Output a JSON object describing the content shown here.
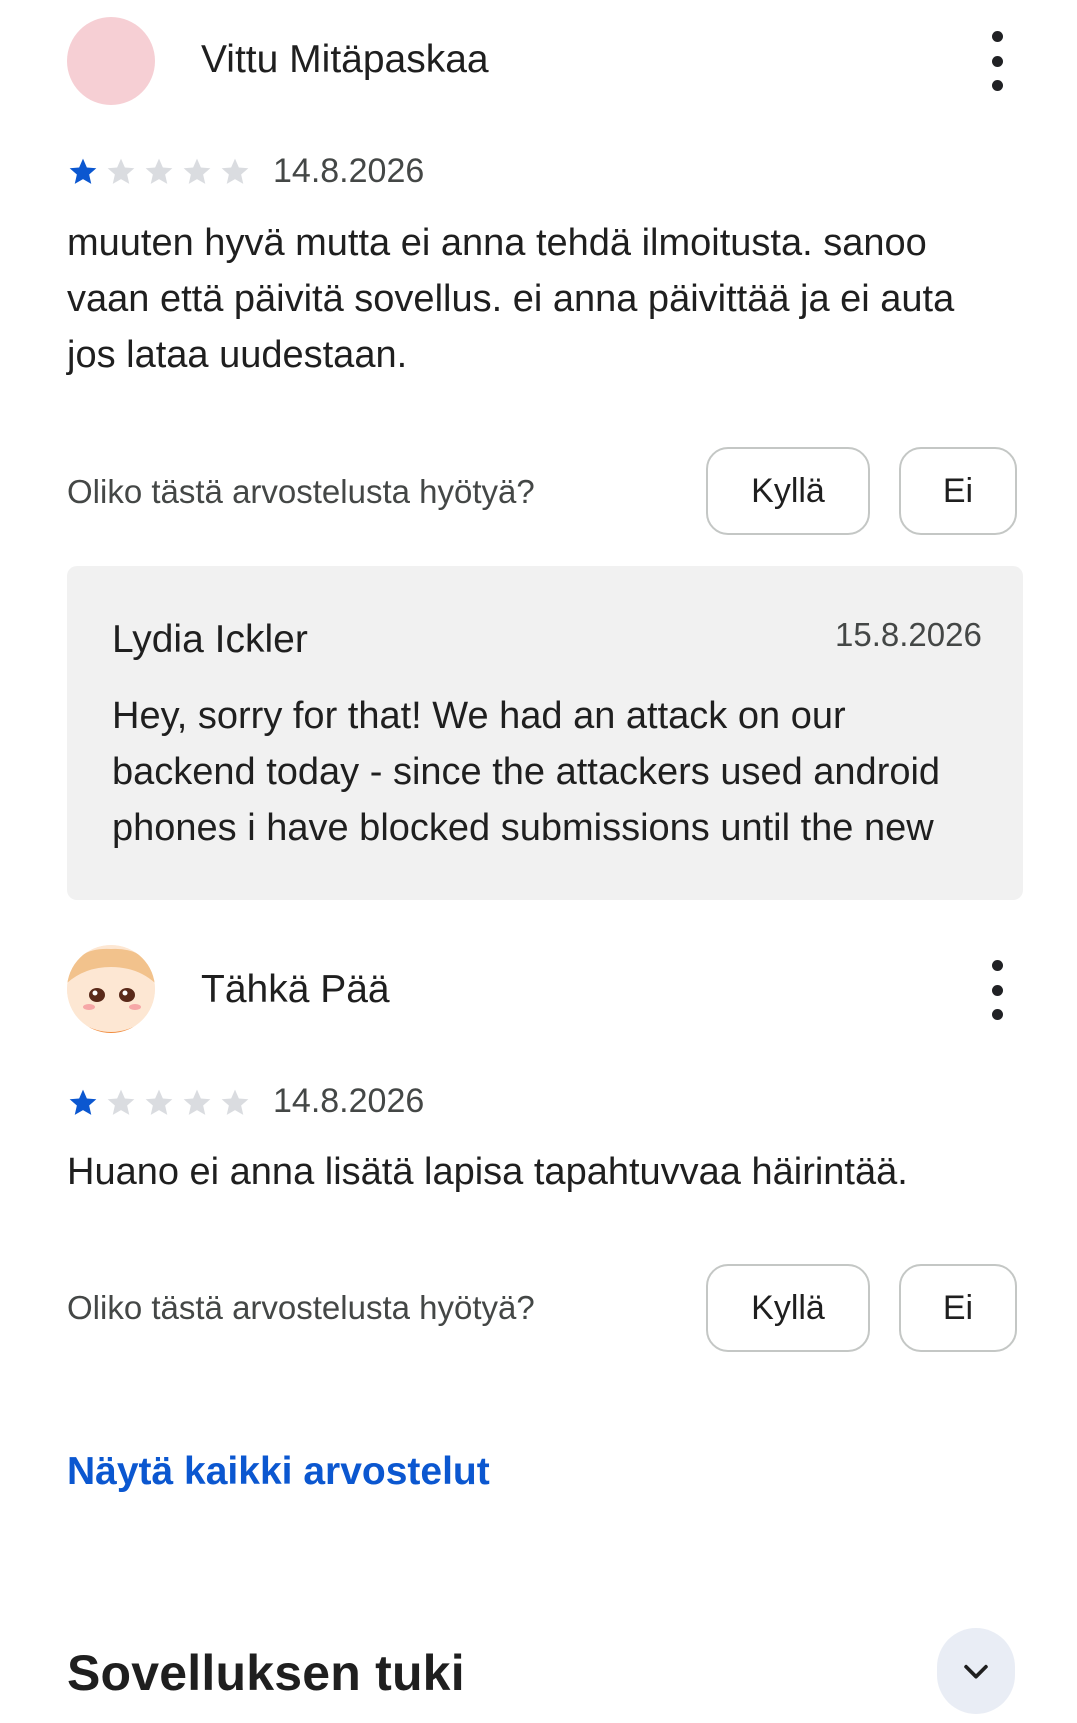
{
  "reviews": [
    {
      "name": "Vittu Mitäpaskaa",
      "rating": 1,
      "max_rating": 5,
      "date": "14.8.2026",
      "text": "muuten hyvä mutta ei anna tehdä ilmoitusta. sanoo vaan että päivitä sovellus. ei anna päivittää ja ei auta jos lataa uudestaan.",
      "helpful_question": "Oliko tästä arvostelusta hyötyä?",
      "yes_label": "Kyllä",
      "no_label": "Ei",
      "reply": {
        "name": "Lydia Ickler",
        "date": "15.8.2026",
        "text": "Hey, sorry for that! We had an attack on our backend today - since the attackers used android phones i have blocked submissions until the new"
      }
    },
    {
      "name": "Tähkä Pää",
      "rating": 1,
      "max_rating": 5,
      "date": "14.8.2026",
      "text": "Huano ei anna lisätä lapisa tapahtuvvaa häirintää.",
      "helpful_question": "Oliko tästä arvostelusta hyötyä?",
      "yes_label": "Kyllä",
      "no_label": "Ei"
    }
  ],
  "show_all_link": "Näytä kaikki arvostelut",
  "support_section": {
    "title": "Sovelluksen tuki"
  },
  "colors": {
    "star_filled": "#0b57d0",
    "star_empty": "#dadce0",
    "link": "#0b57d0",
    "reply_bg": "#f1f1f1"
  }
}
